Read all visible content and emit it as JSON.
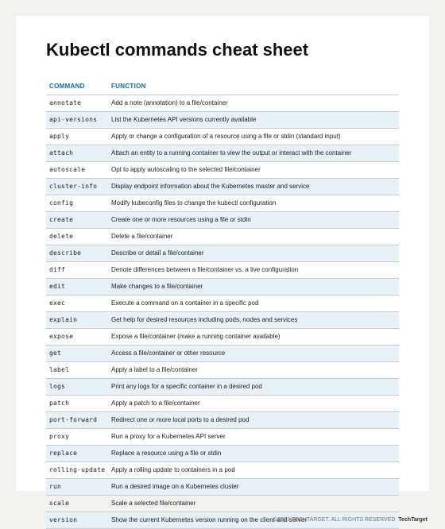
{
  "title": "Kubectl commands cheat sheet",
  "columns": {
    "command": "COMMAND",
    "function": "FUNCTION"
  },
  "rows": [
    {
      "cmd": "annotate",
      "desc": "Add a note (annotation) to a file/container"
    },
    {
      "cmd": "api-versions",
      "desc": "List the Kubernetes API versions currently available"
    },
    {
      "cmd": "apply",
      "desc": "Apply or change a configuration of a resource using a file or stdin (standard input)"
    },
    {
      "cmd": "attach",
      "desc": "Attach an entity to a running container to view the output or interact with the container"
    },
    {
      "cmd": "autoscale",
      "desc": "Opt to apply autoscaling to the selected file/container"
    },
    {
      "cmd": "cluster-info",
      "desc": "Display endpoint information about the Kubernetes master and service"
    },
    {
      "cmd": "config",
      "desc": "Modify kubeconfig files to change the kubectl configuration"
    },
    {
      "cmd": "create",
      "desc": "Create one or more resources using a file or stdin"
    },
    {
      "cmd": "delete",
      "desc": "Delete a file/container"
    },
    {
      "cmd": "describe",
      "desc": "Describe or detail a file/container"
    },
    {
      "cmd": "diff",
      "desc": "Denote differences between a file/container vs. a live configuration"
    },
    {
      "cmd": "edit",
      "desc": "Make changes to a file/container"
    },
    {
      "cmd": "exec",
      "desc": "Execute a command on a container in a specific pod"
    },
    {
      "cmd": "explain",
      "desc": "Get help for desired resources including pods, nodes and services"
    },
    {
      "cmd": "expose",
      "desc": "Expose a file/container (make a running container available)"
    },
    {
      "cmd": "get",
      "desc": "Access a file/container or other resource"
    },
    {
      "cmd": "label",
      "desc": "Apply a label to a file/container"
    },
    {
      "cmd": "logs",
      "desc": "Print any logs for a specific container in a desired pod"
    },
    {
      "cmd": "patch",
      "desc": "Apply a patch to a file/container"
    },
    {
      "cmd": "port-forward",
      "desc": "Redirect one or more local ports to a desired pod"
    },
    {
      "cmd": "proxy",
      "desc": "Run a proxy for a Kubernetes API server"
    },
    {
      "cmd": "replace",
      "desc": "Replace a resource using a file or stdin"
    },
    {
      "cmd": "rolling-update",
      "desc": "Apply a rolling update to containers in a pod"
    },
    {
      "cmd": "run",
      "desc": "Run a desired image on a Kubernetes cluster"
    },
    {
      "cmd": "scale",
      "desc": "Scale a selected file/container"
    },
    {
      "cmd": "version",
      "desc": "Show the current Kubernetes version running on the client and server"
    }
  ],
  "footer": {
    "copyright": "©2021 TECHTARGET. ALL RIGHTS RESERVED",
    "brand": "TechTarget"
  }
}
